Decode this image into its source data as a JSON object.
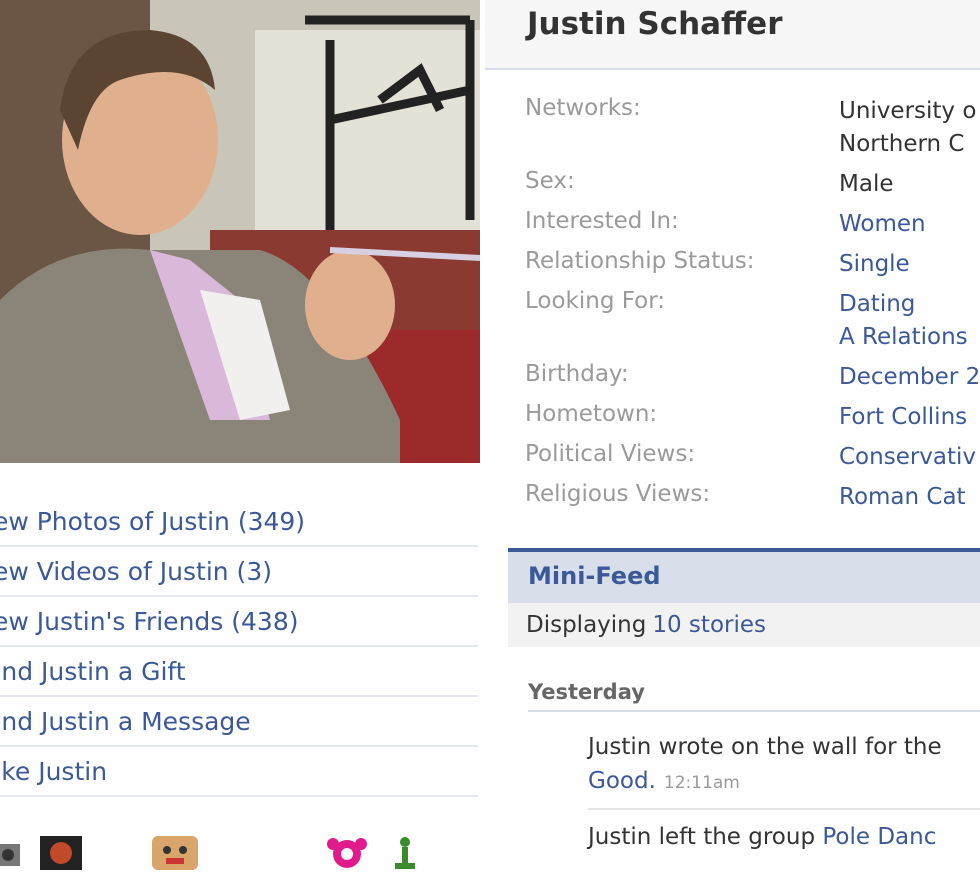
{
  "profile": {
    "name": "Justin Schaffer"
  },
  "actions": [
    "iew Photos of Justin (349)",
    "iew Videos of Justin (3)",
    "iew Justin's Friends (438)",
    "end Justin a Gift",
    "end Justin a Message",
    "oke Justin"
  ],
  "info": [
    {
      "label": "Networks:",
      "value": "University o\nNorthern C",
      "plain": true
    },
    {
      "label": "Sex:",
      "value": "Male",
      "plain": true
    },
    {
      "label": "Interested In:",
      "value": "Women"
    },
    {
      "label": "Relationship Status:",
      "value": "Single"
    },
    {
      "label": "Looking For:",
      "value": "Dating\nA Relations"
    },
    {
      "label": "Birthday:",
      "value": "December 2"
    },
    {
      "label": "Hometown:",
      "value": "Fort Collins"
    },
    {
      "label": "Political Views:",
      "value": "Conservativ"
    },
    {
      "label": "Religious Views:",
      "value": "Roman Cat"
    }
  ],
  "minifeed": {
    "title": "Mini-Feed",
    "displaying_prefix": "Displaying",
    "displaying_link": "10 stories",
    "day": "Yesterday",
    "story1_text": "Justin wrote on the wall for the",
    "story1_link": "Good.",
    "story1_time": "12:11am",
    "story2_text": "Justin left the group",
    "story2_link": "Pole Danc"
  },
  "app_icons": [
    "camera-icon",
    "photo-app-icon",
    "face-app-icon",
    "flower-icon",
    "figure-icon"
  ],
  "colors": {
    "link": "#3b5998",
    "label": "#9a9a9a",
    "header_bg": "#d8dfea"
  }
}
